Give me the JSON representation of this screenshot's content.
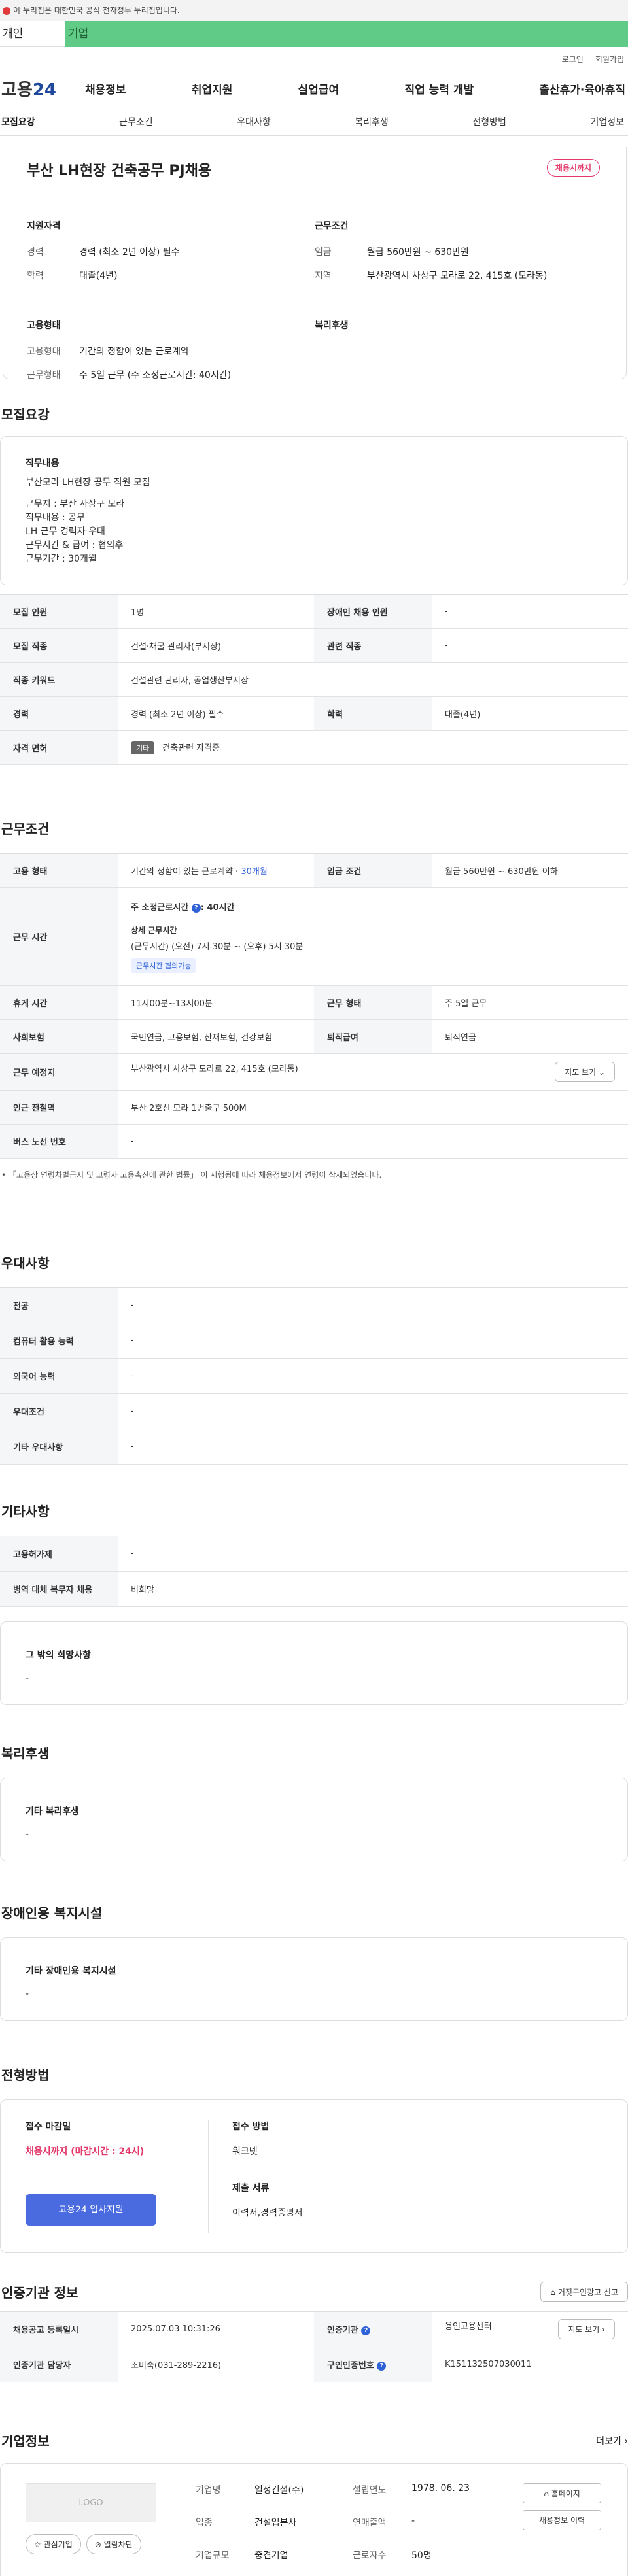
{
  "gov_banner": "이 누리집은 대한민국 공식 전자정부 누리집입니다.",
  "tabs": {
    "person": "개인",
    "company": "기업"
  },
  "util": {
    "login": "로그인",
    "signup": "회원가입"
  },
  "gnb": {
    "logo_prefix": "고용",
    "logo_num": "24",
    "menu": [
      "채용정보",
      "취업지원",
      "실업급여",
      "직업 능력 개발",
      "출산휴가·육아휴직"
    ]
  },
  "subnav": [
    "모집요강",
    "근무조건",
    "우대사항",
    "복리후생",
    "전형방법",
    "기업정보"
  ],
  "summary": {
    "title": "부산 LH현장 건축공무 PJ채용",
    "badge": "채용시까지",
    "qual_title": "지원자격",
    "qual": [
      {
        "k": "경력",
        "v": "경력 (최소 2년 이상) 필수"
      },
      {
        "k": "학력",
        "v": "대졸(4년)"
      }
    ],
    "cond_title": "근무조건",
    "cond": [
      {
        "k": "임금",
        "v": "월급 560만원 ~ 630만원"
      },
      {
        "k": "지역",
        "v": "부산광역시 사상구 모라로 22, 415호 (모라동)"
      }
    ],
    "emp_title": "고용형태",
    "emp": [
      {
        "k": "고용형태",
        "v": "기간의 정함이 있는 근로계약"
      },
      {
        "k": "근무형태",
        "v": "주 5일 근무 (주 소정근로시간: 40시간)"
      }
    ],
    "welfare_title": "복리후생"
  },
  "recruit": {
    "title": "모집요강",
    "duty_title": "직무내용",
    "duty_lines": [
      "부산모라 LH현장 공무 직원 모집",
      "",
      "근무지 : 부산 사상구 모라",
      "직무내용 : 공무",
      "LH 근무 경력자 우대",
      "근무시간 & 급여 : 협의후",
      "근무기간 : 30개월"
    ],
    "rows": [
      {
        "k1": "모집 인원",
        "v1": "1명",
        "k2": "장애인 채용 인원",
        "v2": "-"
      },
      {
        "k1": "모집 직종",
        "v1": "건설·채굴 관리자(부서장)",
        "k2": "관련 직종",
        "v2": "-"
      },
      {
        "k1": "직종 키워드",
        "v1": "건설관련 관리자, 공업생산부서장"
      },
      {
        "k1": "경력",
        "v1": "경력 (최소 2년 이상) 필수",
        "k2": "학력",
        "v2": "대졸(4년)"
      }
    ],
    "license_k": "자격 면허",
    "license_tag": "기타",
    "license_v": "건축관련 자격증"
  },
  "work": {
    "title": "근무조건",
    "emp_k": "고용 형태",
    "emp_v": "기간의 정함이 있는 근로계약 · ",
    "emp_period": "30개월",
    "wage_k": "임금 조건",
    "wage_v": "월급 560만원 ~ 630만원 이하",
    "time_k": "근무 시간",
    "time_main": "주 소정근로시간 ",
    "time_main2": ": 40시간",
    "time_detail_title": "상세 근무시간",
    "time_detail": "(근무시간) (오전) 7시 30분 ~ (오후) 5시 30분",
    "time_tag": "근무시간 협의가능",
    "rest_k": "휴게 시간",
    "rest_v": "11시00분~13시00분",
    "form_k": "근무 형태",
    "form_v": "주 5일 근무",
    "ins_k": "사회보험",
    "ins_v": "국민연금, 고용보험, 산재보험, 건강보험",
    "retire_k": "퇴직급여",
    "retire_v": "퇴직연금",
    "addr_k": "근무 예정지",
    "addr_v": "부산광역시 사상구 모라로 22, 415호 (모라동)",
    "map_btn": "지도 보기",
    "subway_k": "인근 전철역",
    "subway_v": "부산 2호선 모라 1번출구 500M",
    "bus_k": "버스 노선 번호",
    "bus_v": "-",
    "note": "「고용상 연령차별금지 및 고령자 고용촉진에 관한 법률」 이 시행됨에 따라 채용정보에서 연령이 삭제되었습니다."
  },
  "pref": {
    "title": "우대사항",
    "rows": [
      {
        "k": "전공",
        "v": "-"
      },
      {
        "k": "컴퓨터 활용 능력",
        "v": "-"
      },
      {
        "k": "외국어 능력",
        "v": "-"
      },
      {
        "k": "우대조건",
        "v": "-"
      },
      {
        "k": "기타 우대사항",
        "v": "-"
      }
    ]
  },
  "etc": {
    "title": "기타사항",
    "rows": [
      {
        "k": "고용허가제",
        "v": "-"
      },
      {
        "k": "병역 대체 복무자 채용",
        "v": "비희망"
      }
    ],
    "other_title": "그 밖의 희망사항",
    "other_v": "-"
  },
  "welfare": {
    "title": "복리후생",
    "box_title": "기타 복리후생",
    "box_v": "-"
  },
  "disabled": {
    "title": "장애인용 복지시설",
    "box_title": "기타 장애인용 복지시설",
    "box_v": "-"
  },
  "apply": {
    "title": "전형방법",
    "deadline_title": "접수 마감일",
    "deadline_v": "채용시까지 (마감시간 : 24시)",
    "apply_btn": "고용24 입사지원",
    "method_title": "접수 방법",
    "method_v": "워크넷",
    "docs_title": "제출 서류",
    "docs_v": "이력서,경력증명서"
  },
  "cert": {
    "title": "인증기관 정보",
    "report_btn": "거짓구인광고 신고",
    "rows": [
      {
        "k1": "채용공고 등록일시",
        "v1": "2025.07.03 10:31:26",
        "k2": "인증기관",
        "v2": "용인고용센터",
        "btn": "지도 보기"
      },
      {
        "k1": "인증기관 담당자",
        "v1": "조미숙(031-289-2216)",
        "k2": "구인인증번호",
        "v2": "K151132507030011"
      }
    ]
  },
  "company": {
    "title": "기업정보",
    "more": "더보기",
    "logo": "LOGO",
    "interest_btn": "관심기업",
    "block_btn": "열람차단",
    "fields": [
      {
        "k": "기업명",
        "v": "일성건설(주)"
      },
      {
        "k": "설립연도",
        "v": "1978. 06. 23"
      },
      {
        "k": "업종",
        "v": "건설업본사"
      },
      {
        "k": "연매출액",
        "v": "-"
      },
      {
        "k": "기업규모",
        "v": "중견기업"
      },
      {
        "k": "근로자수",
        "v": "50명"
      }
    ],
    "homepage_btn": "홈페이지",
    "history_btn": "채용정보 이력"
  }
}
